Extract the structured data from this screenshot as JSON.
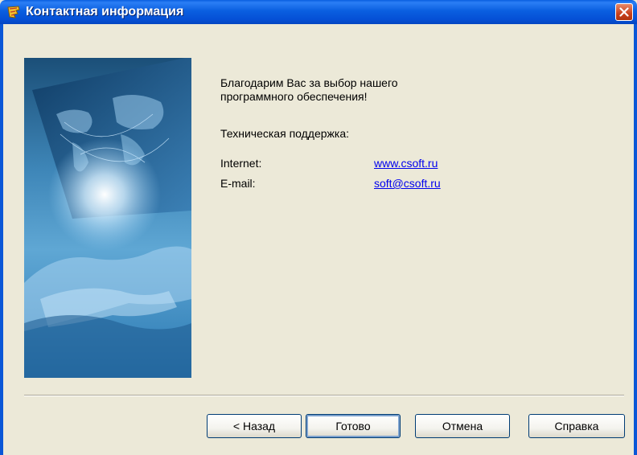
{
  "window": {
    "title": "Контактная информация"
  },
  "content": {
    "thanks_line1": "Благодарим Вас за выбор нашего",
    "thanks_line2": "программного обеспечения!",
    "support_heading": "Техническая поддержка:",
    "internet_label": "Internet:",
    "internet_link": "www.csoft.ru",
    "email_label": "E-mail:",
    "email_link": "soft@csoft.ru"
  },
  "buttons": {
    "back": "< Назад",
    "finish": "Готово",
    "cancel": "Отмена",
    "help": "Справка"
  },
  "colors": {
    "titlebar": "#0A5FE0",
    "dialog_bg": "#ECE9D8",
    "link": "#0000EE",
    "close_button": "#C8401C"
  }
}
